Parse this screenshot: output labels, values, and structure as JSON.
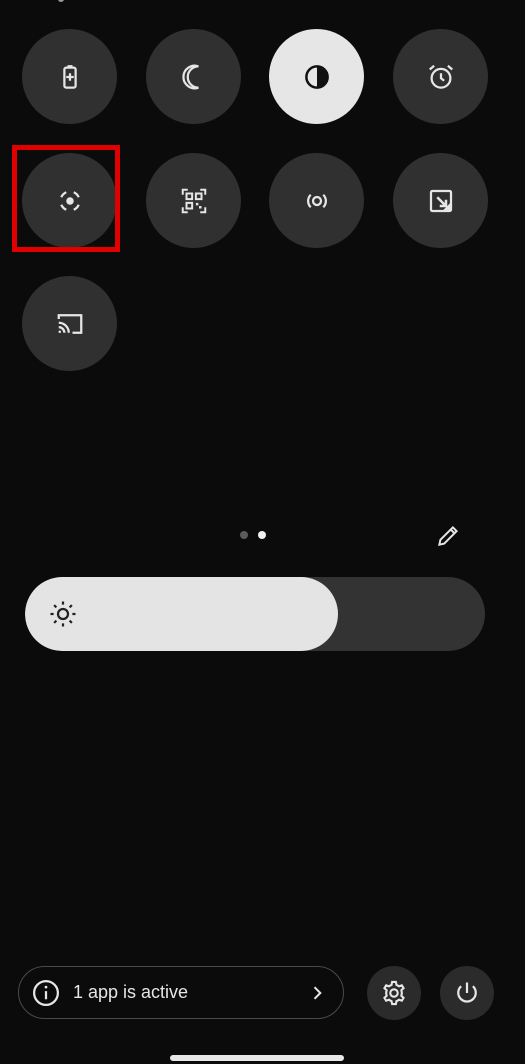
{
  "quick_settings": {
    "tiles": [
      {
        "name": "battery-saver",
        "icon": "battery-plus-icon",
        "active": false
      },
      {
        "name": "bedtime-mode",
        "icon": "moon-icon",
        "active": false
      },
      {
        "name": "dark-theme",
        "icon": "contrast-icon",
        "active": true
      },
      {
        "name": "alarm",
        "icon": "alarm-clock-icon",
        "active": false
      },
      {
        "name": "screen-record",
        "icon": "screen-record-icon",
        "active": false,
        "highlighted": true
      },
      {
        "name": "qr-scanner",
        "icon": "qr-code-icon",
        "active": false
      },
      {
        "name": "hotspot",
        "icon": "hotspot-icon",
        "active": false
      },
      {
        "name": "screen-rotate",
        "icon": "auto-rotate-icon",
        "active": false
      },
      {
        "name": "cast",
        "icon": "cast-icon",
        "active": false
      }
    ],
    "pages": {
      "count": 2,
      "current": 2
    }
  },
  "brightness": {
    "icon": "sun-icon",
    "level": 0.68
  },
  "footer": {
    "active_apps_label": "1 app is active",
    "settings_icon": "gear-icon",
    "power_icon": "power-icon"
  },
  "colors": {
    "background": "#0b0b0b",
    "tile": "#303030",
    "tile_active": "#e6e6e6",
    "highlight": "#e00000"
  }
}
